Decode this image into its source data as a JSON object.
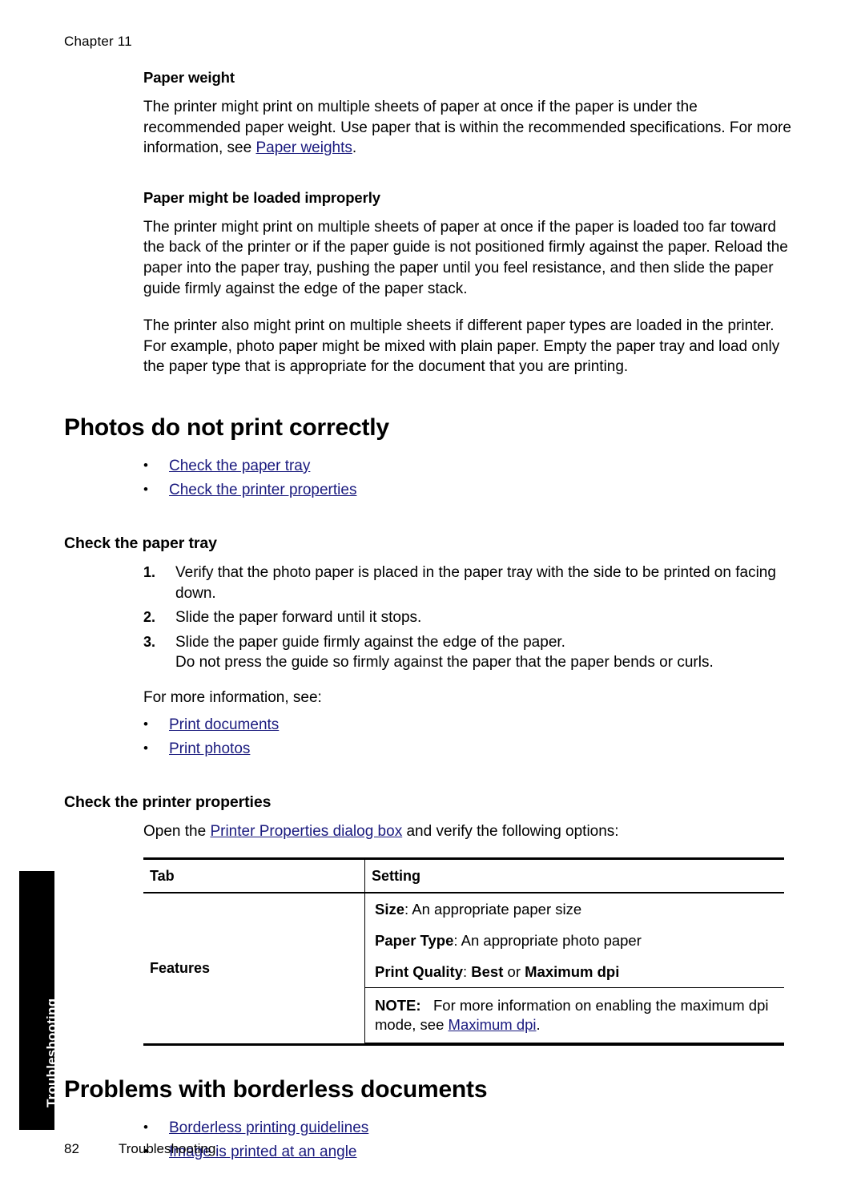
{
  "header": {
    "chapter": "Chapter 11"
  },
  "sections": {
    "paper_weight": {
      "heading": "Paper weight",
      "para1_a": "The printer might print on multiple sheets of paper at once if the paper is under the recommended paper weight. Use paper that is within the recommended specifications. For more information, see ",
      "para1_link": "Paper weights",
      "para1_b": "."
    },
    "loaded_improperly": {
      "heading": "Paper might be loaded improperly",
      "para1": "The printer might print on multiple sheets of paper at once if the paper is loaded too far toward the back of the printer or if the paper guide is not positioned firmly against the paper. Reload the paper into the paper tray, pushing the paper until you feel resistance, and then slide the paper guide firmly against the edge of the paper stack.",
      "para2": "The printer also might print on multiple sheets if different paper types are loaded in the printer. For example, photo paper might be mixed with plain paper. Empty the paper tray and load only the paper type that is appropriate for the document that you are printing."
    },
    "photos": {
      "title": "Photos do not print correctly",
      "links": [
        "Check the paper tray",
        "Check the printer properties"
      ]
    },
    "check_paper_tray": {
      "heading": "Check the paper tray",
      "steps": [
        "Verify that the photo paper is placed in the paper tray with the side to be printed on facing down.",
        "Slide the paper forward until it stops.",
        "Slide the paper guide firmly against the edge of the paper."
      ],
      "step3_extra": "Do not press the guide so firmly against the paper that the paper bends or curls.",
      "more_info": "For more information, see:",
      "links": [
        "Print documents",
        "Print photos"
      ]
    },
    "check_printer_properties": {
      "heading": "Check the printer properties",
      "intro_a": "Open the ",
      "intro_link": "Printer Properties dialog box",
      "intro_b": " and verify the following options:",
      "table": {
        "headers": [
          "Tab",
          "Setting"
        ],
        "row_tab": "Features",
        "settings": [
          {
            "label": "Size",
            "text": ": An appropriate paper size"
          },
          {
            "label": "Paper Type",
            "text": ": An appropriate photo paper"
          },
          {
            "label": "Print Quality",
            "text": ": ",
            "bold1": "Best",
            "mid": " or ",
            "bold2": "Maximum dpi"
          }
        ],
        "note": {
          "label": "NOTE:",
          "text_a": "For more information on enabling the maximum dpi mode, see ",
          "link": "Maximum dpi",
          "text_b": "."
        }
      }
    },
    "borderless": {
      "title": "Problems with borderless documents",
      "links": [
        "Borderless printing guidelines",
        "Image is printed at an angle"
      ]
    }
  },
  "side_tab": {
    "label": "Troubleshooting"
  },
  "footer": {
    "page_number": "82",
    "section_name": "Troubleshooting"
  },
  "colors": {
    "link": "#1a1a7e",
    "tab_background": "#000000"
  }
}
